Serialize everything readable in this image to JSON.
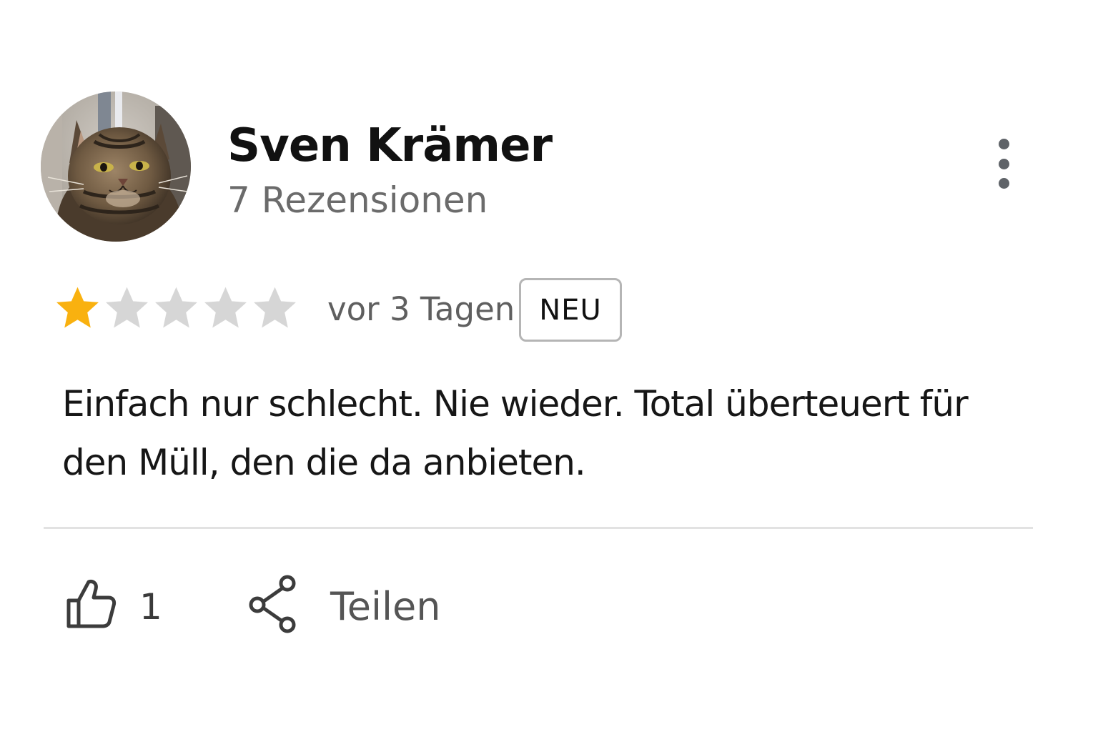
{
  "review": {
    "author_name": "Sven Krämer",
    "review_count": "7 Rezensionen",
    "rating": 1,
    "max_rating": 5,
    "date": "vor 3 Tagen",
    "badge": "NEU",
    "text": "Einfach nur schlecht. Nie wieder. Total überteuert für den Müll, den die da anbieten.",
    "like_count": "1",
    "share_label": "Teilen"
  },
  "icons": {
    "avatar": "cat-photo-avatar",
    "more": "more-vert-icon",
    "like": "thumbs-up-icon",
    "share": "share-icon",
    "star": "star-icon"
  },
  "colors": {
    "star_filled": "#F9B10F",
    "star_empty": "#D6D6D6",
    "icon_dark": "#3c3c3c"
  }
}
